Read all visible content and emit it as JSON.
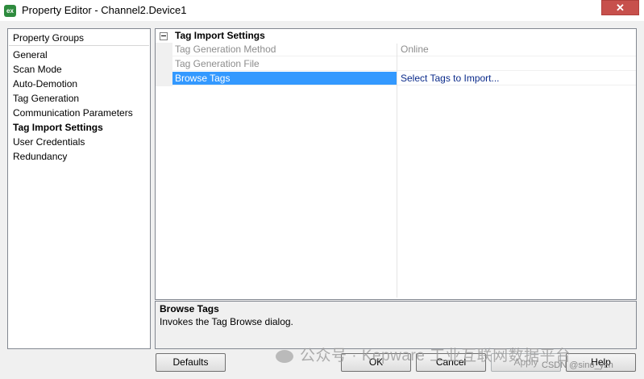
{
  "window": {
    "title": "Property Editor - Channel2.Device1",
    "icon_text": "ex",
    "close_symbol": "✕"
  },
  "property_groups": {
    "header": "Property Groups",
    "items": [
      {
        "label": "General"
      },
      {
        "label": "Scan Mode"
      },
      {
        "label": "Auto-Demotion"
      },
      {
        "label": "Tag Generation"
      },
      {
        "label": "Communication Parameters"
      },
      {
        "label": "Tag Import Settings",
        "selected": true
      },
      {
        "label": "User Credentials"
      },
      {
        "label": "Redundancy"
      }
    ]
  },
  "property_grid": {
    "group_label": "Tag Import Settings",
    "rows": [
      {
        "name": "Tag Generation Method",
        "value": "Online",
        "disabled": true
      },
      {
        "name": "Tag Generation File",
        "value": "",
        "disabled": true
      },
      {
        "name": "Browse Tags",
        "value": "Select Tags to Import...",
        "selected": true
      }
    ]
  },
  "description": {
    "title": "Browse Tags",
    "text": "Invokes the Tag Browse dialog."
  },
  "buttons": {
    "defaults": "Defaults",
    "ok": "OK",
    "cancel": "Cancel",
    "apply": "Apply",
    "help": "Help"
  },
  "watermark": {
    "text": "公众号 · Kepware 工业互联网数据平台",
    "credit": "CSDN @sino_yzn"
  },
  "colors": {
    "selection": "#3399ff",
    "close_button": "#c7504c",
    "app_icon": "#2e8b3e"
  }
}
